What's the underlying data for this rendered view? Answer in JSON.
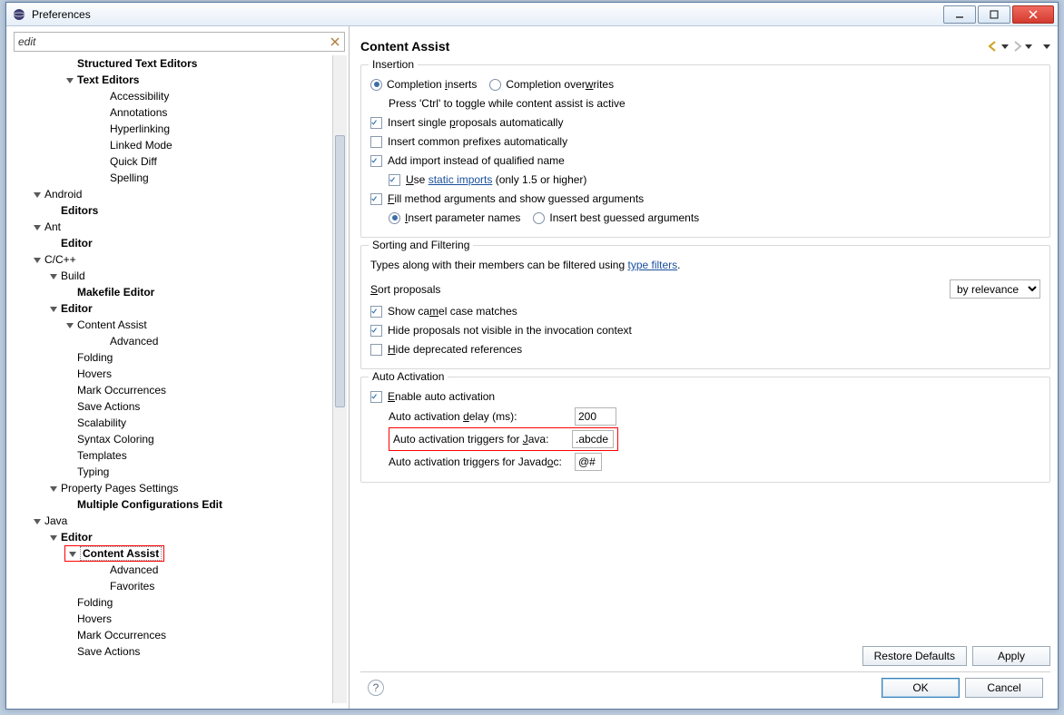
{
  "window": {
    "title": "Preferences"
  },
  "filter": {
    "value": "edit"
  },
  "tree": [
    {
      "lvl": "ind-c",
      "bold": true,
      "label": "Structured Text Editors"
    },
    {
      "lvl": "ind-c",
      "bold": true,
      "label": "Text Editors",
      "expand": true
    },
    {
      "lvl": "ind-e",
      "label": "Accessibility"
    },
    {
      "lvl": "ind-e",
      "label": "Annotations"
    },
    {
      "lvl": "ind-e",
      "label": "Hyperlinking"
    },
    {
      "lvl": "ind-e",
      "label": "Linked Mode"
    },
    {
      "lvl": "ind-e",
      "label": "Quick Diff"
    },
    {
      "lvl": "ind-e",
      "label": "Spelling"
    },
    {
      "lvl": "ind-a",
      "label": "Android",
      "expand": true
    },
    {
      "lvl": "ind-b",
      "bold": true,
      "label": "Editors"
    },
    {
      "lvl": "ind-a",
      "label": "Ant",
      "expand": true
    },
    {
      "lvl": "ind-b",
      "bold": true,
      "label": "Editor"
    },
    {
      "lvl": "ind-a",
      "label": "C/C++",
      "expand": true
    },
    {
      "lvl": "ind-b",
      "label": "Build",
      "expand": true
    },
    {
      "lvl": "ind-c",
      "bold": true,
      "label": "Makefile Editor"
    },
    {
      "lvl": "ind-b",
      "bold": true,
      "label": "Editor",
      "expand": true
    },
    {
      "lvl": "ind-c",
      "label": "Content Assist",
      "expand": true
    },
    {
      "lvl": "ind-e",
      "label": "Advanced"
    },
    {
      "lvl": "ind-c",
      "label": "Folding"
    },
    {
      "lvl": "ind-c",
      "label": "Hovers"
    },
    {
      "lvl": "ind-c",
      "label": "Mark Occurrences"
    },
    {
      "lvl": "ind-c",
      "label": "Save Actions"
    },
    {
      "lvl": "ind-c",
      "label": "Scalability"
    },
    {
      "lvl": "ind-c",
      "label": "Syntax Coloring"
    },
    {
      "lvl": "ind-c",
      "label": "Templates"
    },
    {
      "lvl": "ind-c",
      "label": "Typing"
    },
    {
      "lvl": "ind-b",
      "label": "Property Pages Settings",
      "expand": true
    },
    {
      "lvl": "ind-c",
      "bold": true,
      "label": "Multiple Configurations Edit"
    },
    {
      "lvl": "ind-a",
      "label": "Java",
      "expand": true
    },
    {
      "lvl": "ind-b",
      "bold": true,
      "label": "Editor",
      "expand": true
    },
    {
      "lvl": "ind-c",
      "bold": true,
      "label": "Content Assist",
      "expand": true,
      "selected": true,
      "red": true
    },
    {
      "lvl": "ind-e",
      "label": "Advanced"
    },
    {
      "lvl": "ind-e",
      "label": "Favorites"
    },
    {
      "lvl": "ind-c",
      "label": "Folding"
    },
    {
      "lvl": "ind-c",
      "label": "Hovers"
    },
    {
      "lvl": "ind-c",
      "label": "Mark Occurrences"
    },
    {
      "lvl": "ind-c",
      "label": "Save Actions"
    }
  ],
  "page": {
    "title": "Content Assist"
  },
  "insertion": {
    "title": "Insertion",
    "radio_inserts": "Completion inserts",
    "radio_overwrites": "Completion overwrites",
    "hint": "Press 'Ctrl' to toggle while content assist is active",
    "chk_single": "Insert single proposals automatically",
    "chk_common": "Insert common prefixes automatically",
    "chk_import": "Add import instead of qualified name",
    "chk_static_pre": "Use ",
    "chk_static_link": "static imports",
    "chk_static_post": " (only 1.5 or higher)",
    "chk_fill": "Fill method arguments and show guessed arguments",
    "radio_param": "Insert parameter names",
    "radio_best": "Insert best guessed arguments"
  },
  "sorting": {
    "title": "Sorting and Filtering",
    "hint_pre": "Types along with their members can be filtered using ",
    "hint_link": "type filters",
    "hint_post": ".",
    "sort_label": "Sort proposals",
    "sort_value": "by relevance",
    "chk_camel": "Show camel case matches",
    "chk_hide_inv": "Hide proposals not visible in the invocation context",
    "chk_hide_dep": "Hide deprecated references"
  },
  "auto": {
    "title": "Auto Activation",
    "chk_enable": "Enable auto activation",
    "delay_label": "Auto activation delay (ms):",
    "delay_value": "200",
    "java_label": "Auto activation triggers for Java:",
    "java_value": ".abcde",
    "jdoc_label": "Auto activation triggers for Javadoc:",
    "jdoc_value": "@#"
  },
  "buttons": {
    "restore": "Restore Defaults",
    "apply": "Apply",
    "ok": "OK",
    "cancel": "Cancel"
  }
}
